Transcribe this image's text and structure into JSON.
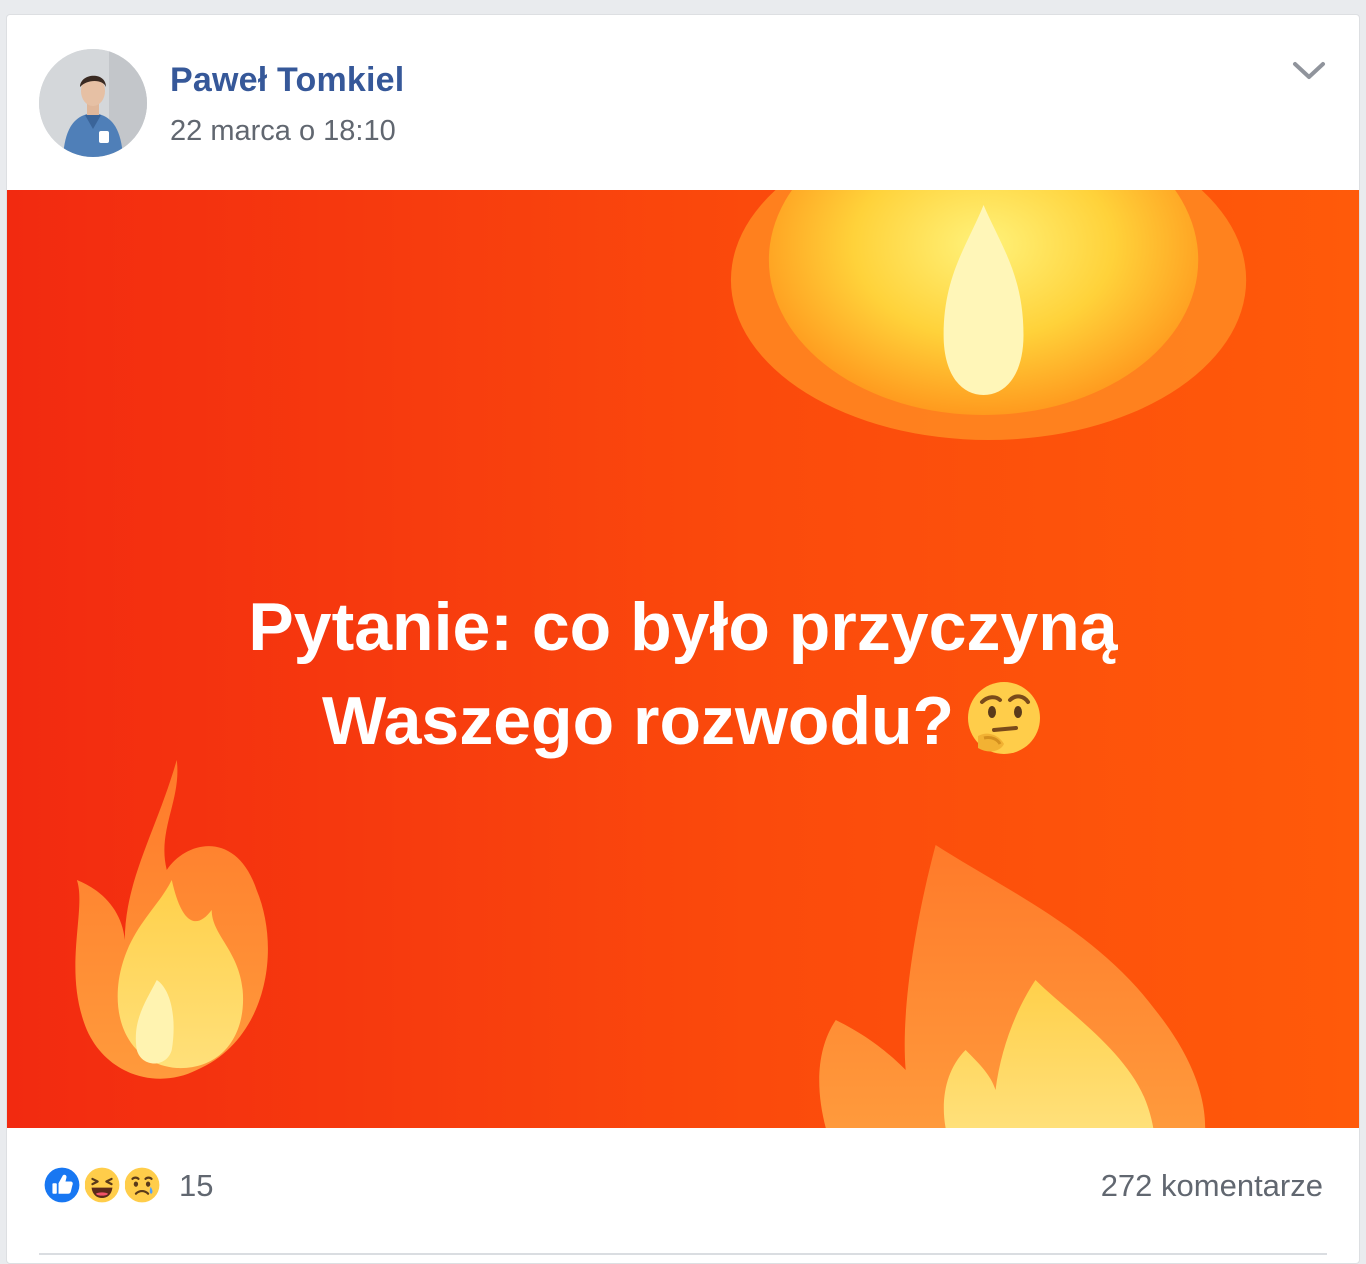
{
  "post": {
    "author": "Paweł Tomkiel",
    "timestamp": "22 marca o 18:10",
    "menu_icon": "chevron-down-icon",
    "avatar_icon": "profile-photo"
  },
  "media": {
    "line1": "Pytanie: co było przyczyną",
    "line2": "Waszego rozwodu?",
    "emoji": "thinking-face-emoji",
    "background_color": "#f53a0e",
    "decoration_icons": [
      "fire-icon",
      "fire-icon",
      "fire-icon"
    ]
  },
  "footer": {
    "reactions": [
      "like-icon",
      "haha-icon",
      "sad-icon"
    ],
    "reaction_count": "15",
    "comments": "272 komentarze"
  },
  "colors": {
    "author": "#365899",
    "meta_text": "#616770",
    "like_blue": "#1877f2",
    "emoji_yellow": "#ffcd4a"
  }
}
